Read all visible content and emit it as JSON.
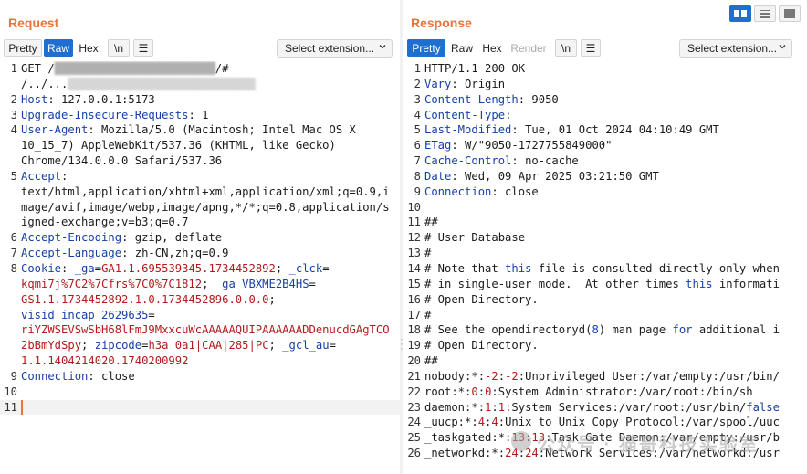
{
  "request": {
    "title": "Request",
    "toolbar": {
      "pretty": "Pretty",
      "raw": "Raw",
      "hex": "Hex",
      "newline": "\\n",
      "menu": "☰",
      "select_extension": "Select extension..."
    },
    "lines": [
      {
        "n": "1",
        "segs": [
          {
            "t": "GET /"
          },
          {
            "t": "████████████████████████",
            "c": "blur"
          },
          {
            "t": "/#"
          }
        ]
      },
      {
        "n": "",
        "segs": [
          {
            "t": "/../..."
          },
          {
            "t": "▒▒▒▒▒▒▒▒▒▒▒▒▒▒▒▒▒▒▒▒▒▒▒▒▒▒▒▒",
            "c": "blur"
          }
        ]
      },
      {
        "n": "2",
        "segs": [
          {
            "t": "Host",
            "c": "hk"
          },
          {
            "t": ": 127.0.0.1:5173"
          }
        ]
      },
      {
        "n": "3",
        "segs": [
          {
            "t": "Upgrade-Insecure-Requests",
            "c": "hk"
          },
          {
            "t": ": 1"
          }
        ]
      },
      {
        "n": "4",
        "segs": [
          {
            "t": "User-Agent",
            "c": "hk"
          },
          {
            "t": ": Mozilla/5.0 (Macintosh; Intel Mac OS X"
          }
        ]
      },
      {
        "n": "",
        "segs": [
          {
            "t": "10_15_7) AppleWebKit/537.36 (KHTML, like Gecko)"
          }
        ]
      },
      {
        "n": "",
        "segs": [
          {
            "t": "Chrome/134.0.0.0 Safari/537.36"
          }
        ]
      },
      {
        "n": "5",
        "segs": [
          {
            "t": "Accept",
            "c": "hk"
          },
          {
            "t": ":"
          }
        ]
      },
      {
        "n": "",
        "segs": [
          {
            "t": "text/html,application/xhtml+xml,application/xml;q=0.9,i"
          }
        ]
      },
      {
        "n": "",
        "segs": [
          {
            "t": "mage/avif,image/webp,image/apng,*/*;q=0.8,application/s"
          }
        ]
      },
      {
        "n": "",
        "segs": [
          {
            "t": "igned-exchange;v=b3;q=0.7"
          }
        ]
      },
      {
        "n": "6",
        "segs": [
          {
            "t": "Accept-Encoding",
            "c": "hk"
          },
          {
            "t": ": gzip, deflate"
          }
        ]
      },
      {
        "n": "7",
        "segs": [
          {
            "t": "Accept-Language",
            "c": "hk"
          },
          {
            "t": ": zh-CN,zh;q=0.9"
          }
        ]
      },
      {
        "n": "8",
        "segs": [
          {
            "t": "Cookie",
            "c": "hk"
          },
          {
            "t": ": "
          },
          {
            "t": "_ga",
            "c": "ck"
          },
          {
            "t": "="
          },
          {
            "t": "GA1.1.695539345.1734452892",
            "c": "cv"
          },
          {
            "t": "; "
          },
          {
            "t": "_clck",
            "c": "ck"
          },
          {
            "t": "="
          }
        ]
      },
      {
        "n": "",
        "segs": [
          {
            "t": "kqmi7j%7C2%7Cfrs%7C0%7C1812",
            "c": "cv"
          },
          {
            "t": "; "
          },
          {
            "t": "_ga_VBXME2B4HS",
            "c": "ck"
          },
          {
            "t": "="
          }
        ]
      },
      {
        "n": "",
        "segs": [
          {
            "t": "GS1.1.1734452892.1.0.1734452896.0.0.0",
            "c": "cv"
          },
          {
            "t": ";"
          }
        ]
      },
      {
        "n": "",
        "segs": [
          {
            "t": "visid_incap_2629635",
            "c": "ck"
          },
          {
            "t": "="
          }
        ]
      },
      {
        "n": "",
        "segs": [
          {
            "t": "riYZWSEVSwSbH68lFmJ9MxxcuWcAAAAAQUIPAAAAAADDenucdGAgTCO",
            "c": "cv"
          }
        ]
      },
      {
        "n": "",
        "segs": [
          {
            "t": "2bBmYdSpy",
            "c": "cv"
          },
          {
            "t": "; "
          },
          {
            "t": "zipcode",
            "c": "ck"
          },
          {
            "t": "="
          },
          {
            "t": "h3a 0a1|CAA|285|PC",
            "c": "cv"
          },
          {
            "t": "; "
          },
          {
            "t": "_gcl_au",
            "c": "ck"
          },
          {
            "t": "="
          }
        ]
      },
      {
        "n": "",
        "segs": [
          {
            "t": "1.1.1404214020.1740200992",
            "c": "cv"
          }
        ]
      },
      {
        "n": "9",
        "segs": [
          {
            "t": "Connection",
            "c": "hk"
          },
          {
            "t": ": close"
          }
        ]
      },
      {
        "n": "10",
        "segs": []
      },
      {
        "n": "11",
        "segs": [],
        "cur": true
      }
    ]
  },
  "response": {
    "title": "Response",
    "toolbar": {
      "pretty": "Pretty",
      "raw": "Raw",
      "hex": "Hex",
      "render": "Render",
      "newline": "\\n",
      "menu": "☰",
      "select_extension": "Select extension..."
    },
    "lines": [
      {
        "n": "1",
        "segs": [
          {
            "t": "HTTP/1.1 200 OK"
          }
        ]
      },
      {
        "n": "2",
        "segs": [
          {
            "t": "Vary",
            "c": "hk"
          },
          {
            "t": ": Origin"
          }
        ]
      },
      {
        "n": "3",
        "segs": [
          {
            "t": "Content-Length",
            "c": "hk"
          },
          {
            "t": ": 9050"
          }
        ]
      },
      {
        "n": "4",
        "segs": [
          {
            "t": "Content-Type",
            "c": "hk"
          },
          {
            "t": ":"
          }
        ]
      },
      {
        "n": "5",
        "segs": [
          {
            "t": "Last-Modified",
            "c": "hk"
          },
          {
            "t": ": Tue, 01 Oct 2024 04:10:49 GMT"
          }
        ]
      },
      {
        "n": "6",
        "segs": [
          {
            "t": "ETag",
            "c": "hk"
          },
          {
            "t": ": W/\"9050-1727755849000\""
          }
        ]
      },
      {
        "n": "7",
        "segs": [
          {
            "t": "Cache-Control",
            "c": "hk"
          },
          {
            "t": ": no-cache"
          }
        ]
      },
      {
        "n": "8",
        "segs": [
          {
            "t": "Date",
            "c": "hk"
          },
          {
            "t": ": Wed, 09 Apr 2025 03:21:50 GMT"
          }
        ]
      },
      {
        "n": "9",
        "segs": [
          {
            "t": "Connection",
            "c": "hk"
          },
          {
            "t": ": close"
          }
        ]
      },
      {
        "n": "10",
        "segs": []
      },
      {
        "n": "11",
        "segs": [
          {
            "t": "##"
          }
        ]
      },
      {
        "n": "12",
        "segs": [
          {
            "t": "# User Database"
          }
        ]
      },
      {
        "n": "13",
        "segs": [
          {
            "t": "#"
          }
        ]
      },
      {
        "n": "14",
        "segs": [
          {
            "t": "# Note that "
          },
          {
            "t": "this",
            "c": "kw"
          },
          {
            "t": " file is consulted directly only when"
          }
        ]
      },
      {
        "n": "15",
        "segs": [
          {
            "t": "# in single-user mode.  At other times "
          },
          {
            "t": "this",
            "c": "kw"
          },
          {
            "t": " informati"
          }
        ]
      },
      {
        "n": "16",
        "segs": [
          {
            "t": "# Open Directory."
          }
        ]
      },
      {
        "n": "17",
        "segs": [
          {
            "t": "#"
          }
        ]
      },
      {
        "n": "18",
        "segs": [
          {
            "t": "# See the opendirectoryd("
          },
          {
            "t": "8",
            "c": "kw"
          },
          {
            "t": ") man page "
          },
          {
            "t": "for",
            "c": "kw"
          },
          {
            "t": " additional i"
          }
        ]
      },
      {
        "n": "19",
        "segs": [
          {
            "t": "# Open Directory."
          }
        ]
      },
      {
        "n": "20",
        "segs": [
          {
            "t": "##"
          }
        ]
      },
      {
        "n": "21",
        "segs": [
          {
            "t": "nobody:*:"
          },
          {
            "t": "-2",
            "c": "cv"
          },
          {
            "t": ":"
          },
          {
            "t": "-2",
            "c": "cv"
          },
          {
            "t": ":Unprivileged User:/var/empty:/usr/bin/"
          }
        ]
      },
      {
        "n": "22",
        "segs": [
          {
            "t": "root:*:"
          },
          {
            "t": "0",
            "c": "cv"
          },
          {
            "t": ":"
          },
          {
            "t": "0",
            "c": "cv"
          },
          {
            "t": ":System Administrator:/var/root:/bin/sh"
          }
        ]
      },
      {
        "n": "23",
        "segs": [
          {
            "t": "daemon:*:"
          },
          {
            "t": "1",
            "c": "cv"
          },
          {
            "t": ":"
          },
          {
            "t": "1",
            "c": "cv"
          },
          {
            "t": ":System Services:/var/root:/usr/bin/"
          },
          {
            "t": "false",
            "c": "kw"
          }
        ]
      },
      {
        "n": "24",
        "segs": [
          {
            "t": "_uucp:*:"
          },
          {
            "t": "4",
            "c": "cv"
          },
          {
            "t": ":"
          },
          {
            "t": "4",
            "c": "cv"
          },
          {
            "t": ":Unix to Unix Copy Protocol:/var/spool/uuc"
          }
        ]
      },
      {
        "n": "25",
        "segs": [
          {
            "t": "_taskgated:*:"
          },
          {
            "t": "13",
            "c": "cv"
          },
          {
            "t": ":"
          },
          {
            "t": "13",
            "c": "cv"
          },
          {
            "t": ":Task Gate Daemon:/var/empty:/usr/b"
          }
        ]
      },
      {
        "n": "26",
        "segs": [
          {
            "t": "_networkd:*:"
          },
          {
            "t": "24",
            "c": "cv"
          },
          {
            "t": ":"
          },
          {
            "t": "24",
            "c": "cv"
          },
          {
            "t": ":Network Services:/var/networkd:/usr"
          }
        ]
      }
    ]
  },
  "watermark": {
    "text": "公众号 · 猫哥科技实验室"
  },
  "colors": {
    "accent": "#e8743b",
    "active_button": "#1f6fd1",
    "header_key": "#1740a6",
    "cookie_value": "#b11b1b"
  }
}
